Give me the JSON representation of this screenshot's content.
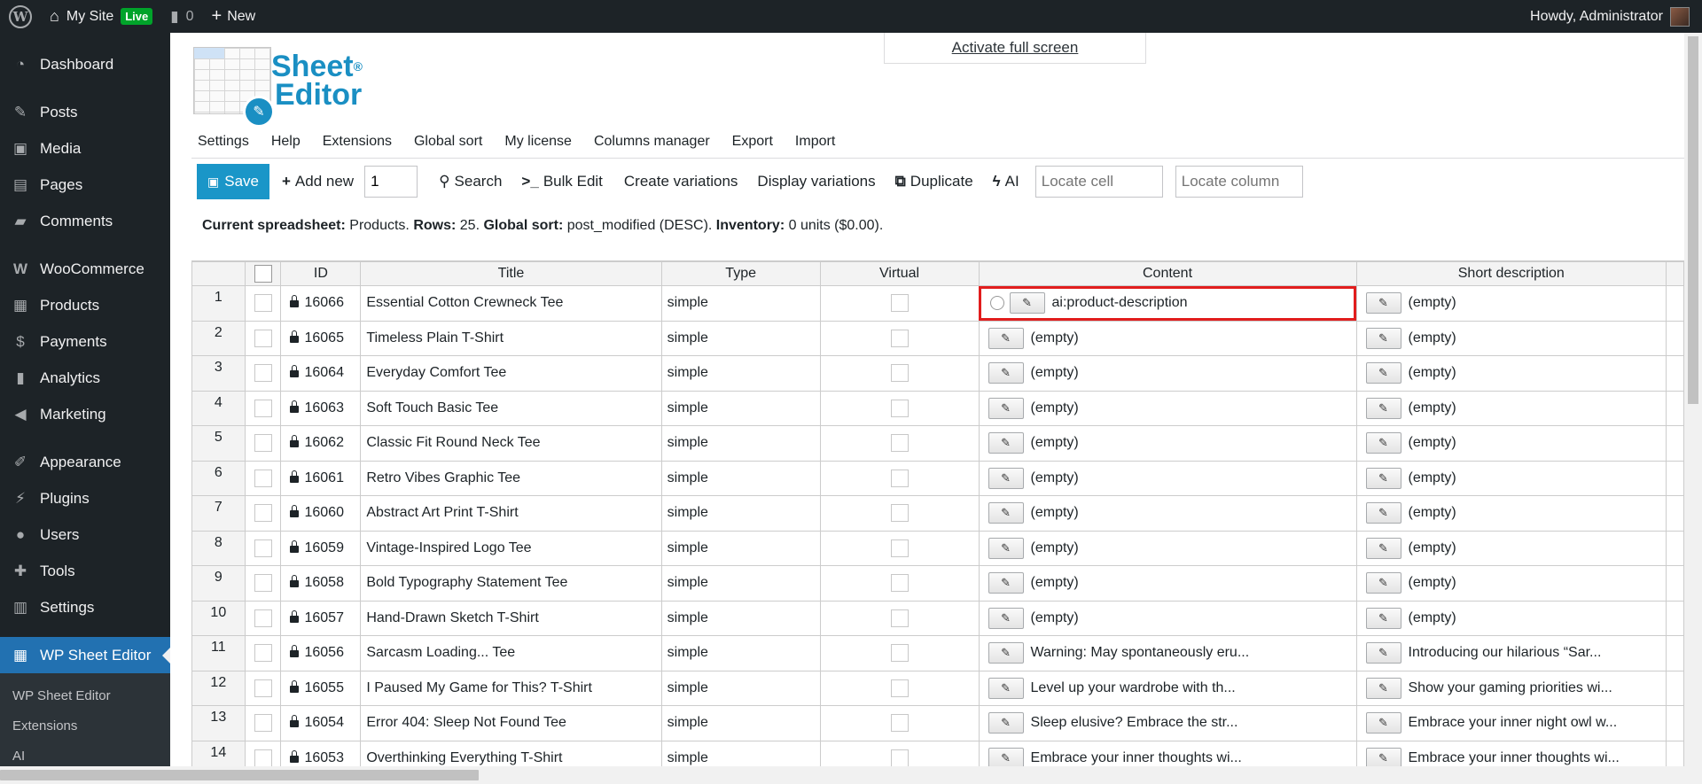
{
  "admin_bar": {
    "site_name": "My Site",
    "live_badge": "Live",
    "comments_count": "0",
    "new_label": "New",
    "greeting": "Howdy, Administrator"
  },
  "sidebar": {
    "items": [
      {
        "label": "Dashboard",
        "icon": "dashboard-icon"
      },
      {
        "label": "Posts",
        "icon": "pushpin-icon"
      },
      {
        "label": "Media",
        "icon": "media-icon"
      },
      {
        "label": "Pages",
        "icon": "pages-icon"
      },
      {
        "label": "Comments",
        "icon": "comment-icon"
      },
      {
        "label": "WooCommerce",
        "icon": "woocommerce-icon"
      },
      {
        "label": "Products",
        "icon": "archive-icon"
      },
      {
        "label": "Payments",
        "icon": "dollar-icon"
      },
      {
        "label": "Analytics",
        "icon": "bar-chart-icon"
      },
      {
        "label": "Marketing",
        "icon": "megaphone-icon"
      },
      {
        "label": "Appearance",
        "icon": "paintbrush-icon"
      },
      {
        "label": "Plugins",
        "icon": "plug-icon"
      },
      {
        "label": "Users",
        "icon": "user-icon"
      },
      {
        "label": "Tools",
        "icon": "wrench-icon"
      },
      {
        "label": "Settings",
        "icon": "settings-icon"
      },
      {
        "label": "WP Sheet Editor",
        "icon": "spreadsheet-icon"
      }
    ],
    "submenu": [
      "WP Sheet Editor",
      "Extensions",
      "AI"
    ]
  },
  "logo": {
    "line1": "Sheet",
    "line2": "Editor",
    "reg": "®"
  },
  "fullscreen_link": "Activate full screen",
  "top_menu": [
    "Settings",
    "Help",
    "Extensions",
    "Global sort",
    "My license",
    "Columns manager",
    "Export",
    "Import"
  ],
  "toolbar": {
    "save": "Save",
    "add_new": "Add new",
    "add_count": "1",
    "search": "Search",
    "bulk_edit": "Bulk Edit",
    "create_variations": "Create variations",
    "display_variations": "Display variations",
    "duplicate": "Duplicate",
    "ai": "AI",
    "locate_cell_placeholder": "Locate cell",
    "locate_column_placeholder": "Locate column"
  },
  "info": {
    "spreadsheet_label": "Current spreadsheet:",
    "spreadsheet_value": "Products.",
    "rows_label": "Rows:",
    "rows_value": "25.",
    "sort_label": "Global sort:",
    "sort_value": "post_modified (DESC).",
    "inventory_label": "Inventory:",
    "inventory_value": "0 units ($0.00)."
  },
  "grid": {
    "columns": [
      "",
      "ID",
      "Title",
      "Type",
      "Virtual",
      "Content",
      "Short description"
    ],
    "rows": [
      {
        "num": "1",
        "id": "16066",
        "title": "Essential Cotton Crewneck Tee",
        "type": "simple",
        "content": "ai:product-description",
        "short": "(empty)"
      },
      {
        "num": "2",
        "id": "16065",
        "title": "Timeless Plain T-Shirt",
        "type": "simple",
        "content": "(empty)",
        "short": "(empty)"
      },
      {
        "num": "3",
        "id": "16064",
        "title": "Everyday Comfort Tee",
        "type": "simple",
        "content": "(empty)",
        "short": "(empty)"
      },
      {
        "num": "4",
        "id": "16063",
        "title": "Soft Touch Basic Tee",
        "type": "simple",
        "content": "(empty)",
        "short": "(empty)"
      },
      {
        "num": "5",
        "id": "16062",
        "title": "Classic Fit Round Neck Tee",
        "type": "simple",
        "content": "(empty)",
        "short": "(empty)"
      },
      {
        "num": "6",
        "id": "16061",
        "title": "Retro Vibes Graphic Tee",
        "type": "simple",
        "content": "(empty)",
        "short": "(empty)"
      },
      {
        "num": "7",
        "id": "16060",
        "title": "Abstract Art Print T-Shirt",
        "type": "simple",
        "content": "(empty)",
        "short": "(empty)"
      },
      {
        "num": "8",
        "id": "16059",
        "title": "Vintage-Inspired Logo Tee",
        "type": "simple",
        "content": "(empty)",
        "short": "(empty)"
      },
      {
        "num": "9",
        "id": "16058",
        "title": "Bold Typography Statement Tee",
        "type": "simple",
        "content": "(empty)",
        "short": "(empty)"
      },
      {
        "num": "10",
        "id": "16057",
        "title": "Hand-Drawn Sketch T-Shirt",
        "type": "simple",
        "content": "(empty)",
        "short": "(empty)"
      },
      {
        "num": "11",
        "id": "16056",
        "title": "Sarcasm Loading... Tee",
        "type": "simple",
        "content": "Warning: May spontaneously eru...",
        "short": "Introducing our hilarious “Sar..."
      },
      {
        "num": "12",
        "id": "16055",
        "title": "I Paused My Game for This? T-Shirt",
        "type": "simple",
        "content": "Level up your wardrobe with th...",
        "short": "Show your gaming priorities wi..."
      },
      {
        "num": "13",
        "id": "16054",
        "title": "Error 404: Sleep Not Found Tee",
        "type": "simple",
        "content": "Sleep elusive? Embrace the str...",
        "short": "Embrace your inner night owl w..."
      },
      {
        "num": "14",
        "id": "16053",
        "title": "Overthinking Everything T-Shirt",
        "type": "simple",
        "content": "Embrace your inner thoughts wi...",
        "short": "Embrace your inner thoughts wi..."
      }
    ]
  },
  "colors": {
    "accent": "#1a96c8",
    "wp_blue": "#2271b1",
    "admin_dark": "#1d2327",
    "selection": "#e11d1d",
    "live": "#00a32a"
  }
}
